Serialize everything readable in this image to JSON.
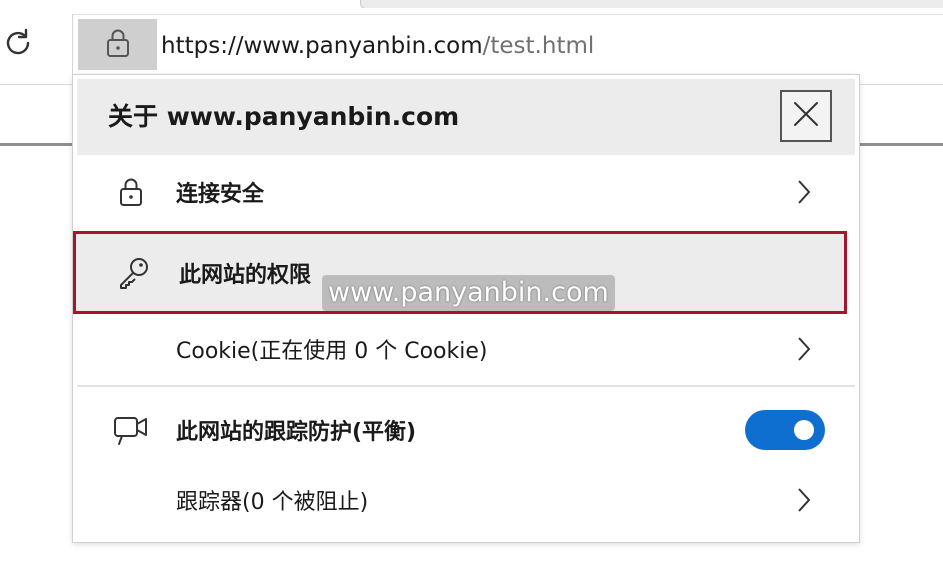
{
  "address_bar": {
    "url_main": "https://www.panyanbin.com",
    "url_path": "/test.html"
  },
  "flyout": {
    "title": "关于 www.panyanbin.com",
    "items": [
      {
        "label": "连接安全",
        "icon": "lock-icon"
      },
      {
        "label": "此网站的权限",
        "icon": "key-icon"
      },
      {
        "label": "Cookie(正在使用 0 个 Cookie)"
      },
      {
        "label": "此网站的跟踪防护(平衡)",
        "icon": "tracking-camera-icon",
        "toggle_on": true
      },
      {
        "label": "跟踪器(0 个被阻止)"
      }
    ]
  },
  "watermark": "www.panyanbin.com",
  "colors": {
    "toggle_on": "#0f6fd1",
    "highlight_border": "#a8142b",
    "header_bg": "#ececec"
  }
}
